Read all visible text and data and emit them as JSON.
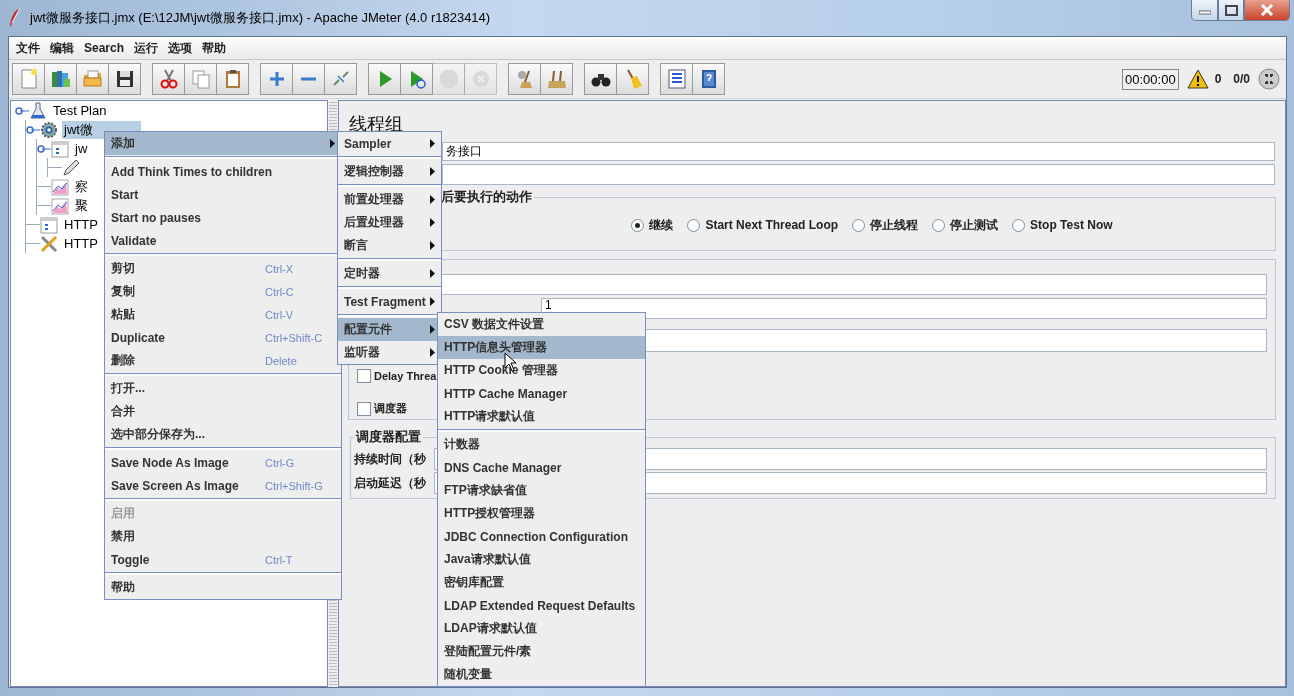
{
  "window": {
    "title": "jwt微服务接口.jmx (E:\\12JM\\jwt微服务接口.jmx) - Apache JMeter (4.0 r1823414)"
  },
  "menubar": [
    {
      "label": "文件"
    },
    {
      "label": "编辑"
    },
    {
      "label": "Search"
    },
    {
      "label": "运行"
    },
    {
      "label": "选项"
    },
    {
      "label": "帮助"
    }
  ],
  "toolbar": {
    "buttons": [
      {
        "disabled": false
      },
      {
        "disabled": false
      },
      {
        "disabled": false
      },
      {
        "disabled": false
      },
      {
        "disabled": false
      },
      {
        "disabled": false
      },
      {
        "disabled": false
      },
      {
        "disabled": false
      },
      {
        "disabled": false
      },
      {
        "disabled": false
      },
      {
        "disabled": false
      },
      {
        "disabled": false
      },
      {
        "disabled": true
      },
      {
        "disabled": true
      },
      {
        "disabled": false
      },
      {
        "disabled": false
      },
      {
        "disabled": false
      },
      {
        "disabled": false
      },
      {
        "disabled": false
      },
      {
        "disabled": false
      }
    ],
    "timer": "00:00:00",
    "warnings": "0",
    "threads": "0/0"
  },
  "tree": [
    {
      "label": "Test Plan",
      "kind": "plan",
      "selected": false,
      "children": [
        {
          "label": "jwt微",
          "kind": "threadgroup",
          "selected": true,
          "children": [
            {
              "label": "jw",
              "kind": "controller",
              "selected": false,
              "children": [
                {
                  "kind": "sampler",
                  "selected": false
                }
              ]
            },
            {
              "label": "察",
              "kind": "listener",
              "selected": false
            },
            {
              "label": "聚",
              "kind": "listener",
              "selected": false
            }
          ]
        },
        {
          "label": "HTTP",
          "kind": "config",
          "selected": false
        },
        {
          "label": "HTTP",
          "kind": "tool",
          "selected": false
        }
      ]
    }
  ],
  "panel": {
    "title": "线程组",
    "name_value": "务接口",
    "action_legend": "后要执行的动作",
    "actions": [
      {
        "label": "继续",
        "selected": true
      },
      {
        "label": "Start Next Thread Loop",
        "selected": false
      },
      {
        "label": "停止线程",
        "selected": false
      },
      {
        "label": "停止测试",
        "selected": false
      },
      {
        "label": "Stop Test Now",
        "selected": false
      }
    ],
    "thread_fields": [
      {
        "kind": "field"
      },
      {
        "kind": "field",
        "value": "1"
      },
      {
        "kind": "field"
      }
    ],
    "checkboxes": [
      {
        "label": "Delay Threa",
        "checked": false
      },
      {
        "label": "调度器",
        "checked": false
      }
    ],
    "scheduler": {
      "legend": "调度器配置",
      "rows": [
        {
          "label": "持续时间（秒"
        },
        {
          "label": "启动延迟（秒"
        }
      ]
    }
  },
  "context_menu": {
    "items": [
      {
        "kind": "submenu",
        "label": "添加",
        "selected": true,
        "disabled": false,
        "submenu": {
          "items": [
            {
              "kind": "submenu",
              "label": "Sampler",
              "selected": false
            },
            {
              "kind": "separator"
            },
            {
              "kind": "submenu",
              "label": "逻辑控制器",
              "selected": false
            },
            {
              "kind": "separator"
            },
            {
              "kind": "submenu",
              "label": "前置处理器",
              "selected": false
            },
            {
              "kind": "submenu",
              "label": "后置处理器",
              "selected": false
            },
            {
              "kind": "submenu",
              "label": "断言",
              "selected": false
            },
            {
              "kind": "separator"
            },
            {
              "kind": "submenu",
              "label": "定时器",
              "selected": false
            },
            {
              "kind": "separator"
            },
            {
              "kind": "submenu",
              "label": "Test Fragment",
              "selected": false
            },
            {
              "kind": "separator"
            },
            {
              "kind": "submenu",
              "label": "配置元件",
              "selected": true,
              "submenu": {
                "items": [
                  {
                    "kind": "item",
                    "label": "CSV 数据文件设置",
                    "selected": false
                  },
                  {
                    "kind": "item",
                    "label": "HTTP信息头管理器",
                    "selected": true
                  },
                  {
                    "kind": "item",
                    "label": "HTTP Cookie 管理器",
                    "selected": false
                  },
                  {
                    "kind": "item",
                    "label": "HTTP Cache Manager",
                    "selected": false
                  },
                  {
                    "kind": "item",
                    "label": "HTTP请求默认值",
                    "selected": false
                  },
                  {
                    "kind": "separator"
                  },
                  {
                    "kind": "item",
                    "label": "计数器",
                    "selected": false
                  },
                  {
                    "kind": "item",
                    "label": "DNS Cache Manager",
                    "selected": false
                  },
                  {
                    "kind": "item",
                    "label": "FTP请求缺省值",
                    "selected": false
                  },
                  {
                    "kind": "item",
                    "label": "HTTP授权管理器",
                    "selected": false
                  },
                  {
                    "kind": "item",
                    "label": "JDBC Connection Configuration",
                    "selected": false
                  },
                  {
                    "kind": "item",
                    "label": "Java请求默认值",
                    "selected": false
                  },
                  {
                    "kind": "item",
                    "label": "密钥库配置",
                    "selected": false
                  },
                  {
                    "kind": "item",
                    "label": "LDAP Extended Request Defaults",
                    "selected": false
                  },
                  {
                    "kind": "item",
                    "label": "LDAP请求默认值",
                    "selected": false
                  },
                  {
                    "kind": "item",
                    "label": "登陆配置元件/素",
                    "selected": false
                  },
                  {
                    "kind": "item",
                    "label": "随机变量",
                    "selected": false
                  }
                ]
              }
            },
            {
              "kind": "submenu",
              "label": "监听器",
              "selected": false
            }
          ]
        }
      },
      {
        "kind": "separator"
      },
      {
        "kind": "item",
        "label": "Add Think Times to children",
        "selected": false,
        "disabled": false
      },
      {
        "kind": "item",
        "label": "Start",
        "selected": false,
        "disabled": false
      },
      {
        "kind": "item",
        "label": "Start no pauses",
        "selected": false,
        "disabled": false
      },
      {
        "kind": "item",
        "label": "Validate",
        "selected": false,
        "disabled": false
      },
      {
        "kind": "separator"
      },
      {
        "kind": "item",
        "label": "剪切",
        "shortcut": "Ctrl-X",
        "selected": false,
        "disabled": false
      },
      {
        "kind": "item",
        "label": "复制",
        "shortcut": "Ctrl-C",
        "selected": false,
        "disabled": false
      },
      {
        "kind": "item",
        "label": "粘贴",
        "shortcut": "Ctrl-V",
        "selected": false,
        "disabled": false
      },
      {
        "kind": "item",
        "label": "Duplicate",
        "shortcut": "Ctrl+Shift-C",
        "selected": false,
        "disabled": false
      },
      {
        "kind": "item",
        "label": "删除",
        "shortcut": "Delete",
        "selected": false,
        "disabled": false
      },
      {
        "kind": "separator"
      },
      {
        "kind": "item",
        "label": "打开...",
        "selected": false,
        "disabled": false
      },
      {
        "kind": "item",
        "label": "合并",
        "selected": false,
        "disabled": false
      },
      {
        "kind": "item",
        "label": "选中部分保存为...",
        "selected": false,
        "disabled": false
      },
      {
        "kind": "separator"
      },
      {
        "kind": "item",
        "label": "Save Node As Image",
        "shortcut": "Ctrl-G",
        "selected": false,
        "disabled": false
      },
      {
        "kind": "item",
        "label": "Save Screen As Image",
        "shortcut": "Ctrl+Shift-G",
        "selected": false,
        "disabled": false
      },
      {
        "kind": "separator"
      },
      {
        "kind": "item",
        "label": "启用",
        "selected": false,
        "disabled": true
      },
      {
        "kind": "item",
        "label": "禁用",
        "selected": false,
        "disabled": false
      },
      {
        "kind": "item",
        "label": "Toggle",
        "shortcut": "Ctrl-T",
        "selected": false,
        "disabled": false
      },
      {
        "kind": "separator"
      },
      {
        "kind": "item",
        "label": "帮助",
        "selected": false,
        "disabled": false
      }
    ]
  }
}
